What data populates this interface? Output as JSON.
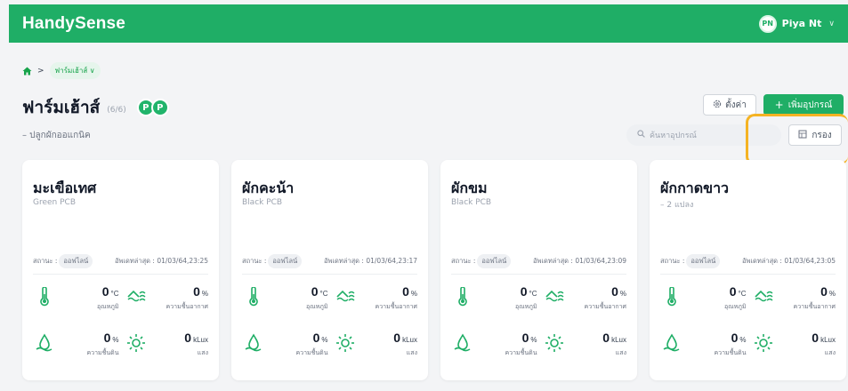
{
  "app": {
    "brand": "HandySense"
  },
  "user": {
    "initials": "PN",
    "name": "Piya Nt"
  },
  "breadcrumb": {
    "current": "ฟาร์มเฮ้าส์ ∨"
  },
  "page": {
    "title": "ฟาร์มเฮ้าส์",
    "count": "(6/6)",
    "badges": [
      "P",
      "P"
    ],
    "subtitle": "– ปลูกผักออแกนิค"
  },
  "toolbar": {
    "settings_label": "ตั้งค่า",
    "add_label": "เพิ่มอุปกรณ์",
    "search_placeholder": "ค้นหาอุปกรณ์",
    "filter_label": "กรอง"
  },
  "colors": {
    "primary": "#1fae66",
    "highlight": "#f5b323"
  },
  "devices": [
    {
      "name": "มะเขือเทศ",
      "board": "Green PCB",
      "status_label": "สถานะ :",
      "status": "ออฟไลน์",
      "updated": "อัพเดทล่าสุด : 01/03/64,23:25",
      "temp": "0",
      "temp_unit": "°C",
      "temp_label": "อุณหภูมิ",
      "humidity": "0",
      "humidity_unit": "%",
      "humidity_label": "ความชื้นอากาศ",
      "soil": "0",
      "soil_unit": "%",
      "soil_label": "ความชื้นดิน",
      "light": "0",
      "light_unit": "kLux",
      "light_label": "แสง"
    },
    {
      "name": "ผักคะน้า",
      "board": "Black PCB",
      "status_label": "สถานะ :",
      "status": "ออฟไลน์",
      "updated": "อัพเดทล่าสุด : 01/03/64,23:17",
      "temp": "0",
      "temp_unit": "°C",
      "temp_label": "อุณหภูมิ",
      "humidity": "0",
      "humidity_unit": "%",
      "humidity_label": "ความชื้นอากาศ",
      "soil": "0",
      "soil_unit": "%",
      "soil_label": "ความชื้นดิน",
      "light": "0",
      "light_unit": "kLux",
      "light_label": "แสง"
    },
    {
      "name": "ผักขม",
      "board": "Black PCB",
      "status_label": "สถานะ :",
      "status": "ออฟไลน์",
      "updated": "อัพเดทล่าสุด : 01/03/64,23:09",
      "temp": "0",
      "temp_unit": "°C",
      "temp_label": "อุณหภูมิ",
      "humidity": "0",
      "humidity_unit": "%",
      "humidity_label": "ความชื้นอากาศ",
      "soil": "0",
      "soil_unit": "%",
      "soil_label": "ความชื้นดิน",
      "light": "0",
      "light_unit": "kLux",
      "light_label": "แสง"
    },
    {
      "name": "ผักกาดขาว",
      "board": "– 2 แปลง",
      "status_label": "สถานะ :",
      "status": "ออฟไลน์",
      "updated": "อัพเดทล่าสุด : 01/03/64,23:05",
      "temp": "0",
      "temp_unit": "°C",
      "temp_label": "อุณหภูมิ",
      "humidity": "0",
      "humidity_unit": "%",
      "humidity_label": "ความชื้นอากาศ",
      "soil": "0",
      "soil_unit": "%",
      "soil_label": "ความชื้นดิน",
      "light": "0",
      "light_unit": "kLux",
      "light_label": "แสง"
    }
  ]
}
